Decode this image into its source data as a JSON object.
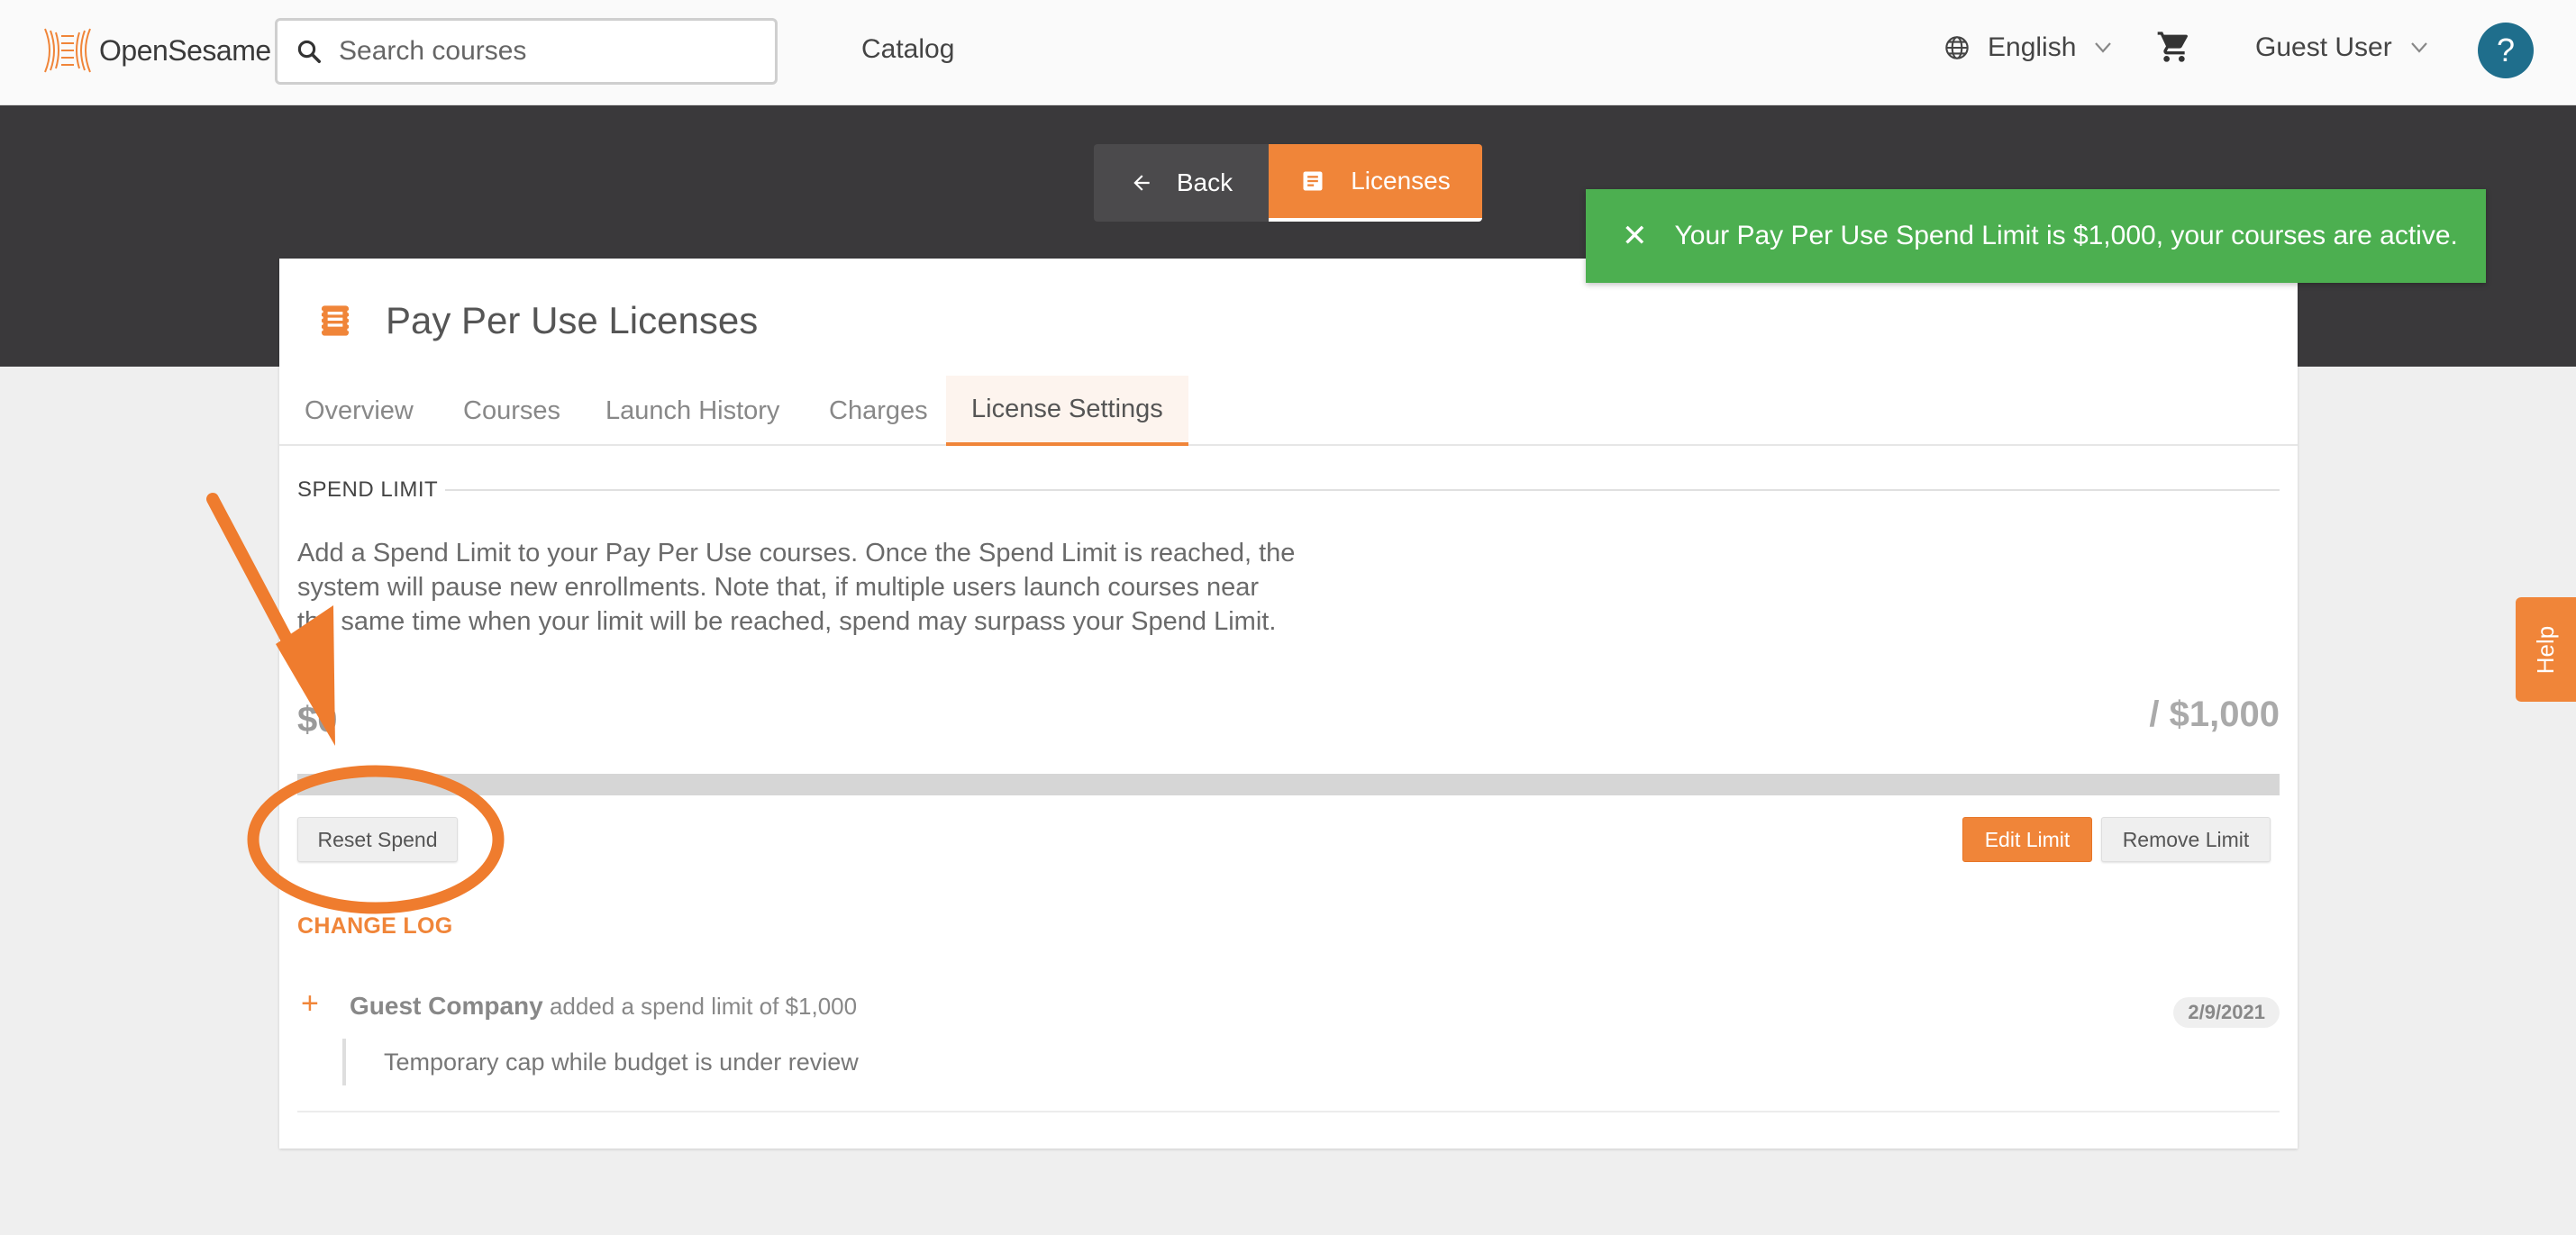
{
  "header": {
    "logo": {
      "text_a": "Open",
      "text_b": "Sesame"
    },
    "search": {
      "placeholder": "Search courses",
      "value": ""
    },
    "nav_catalog": "Catalog",
    "language": "English",
    "user": "Guest User",
    "help_glyph": "?"
  },
  "toolbar": {
    "back_label": "Back",
    "licenses_label": "Licenses"
  },
  "toast": {
    "message": "Your Pay Per Use Spend Limit is $1,000, your courses are active.",
    "close_glyph": "✕",
    "color": "#4caf50"
  },
  "card": {
    "title": "Pay Per Use Licenses",
    "tabs": [
      {
        "label": "Overview",
        "active": false
      },
      {
        "label": "Courses",
        "active": false
      },
      {
        "label": "Launch History",
        "active": false
      },
      {
        "label": "Charges",
        "active": false
      },
      {
        "label": "License Settings",
        "active": true
      }
    ]
  },
  "spend_limit": {
    "heading": "SPEND LIMIT",
    "description": "Add a Spend Limit to your Pay Per Use courses. Once the Spend Limit is reached, the system will pause new enrollments. Note that, if multiple users launch courses near the same time when your limit will be reached, spend may surpass your Spend Limit.",
    "spent": "$0",
    "limit": "/ $1,000",
    "progress_fraction": 0,
    "reset_label": "Reset Spend",
    "edit_label": "Edit Limit",
    "remove_label": "Remove Limit"
  },
  "change_log": {
    "heading": "CHANGE LOG",
    "entries": [
      {
        "actor": "Guest Company",
        "action": "added a spend limit of $1,000",
        "date": "2/9/2021",
        "note": "Temporary cap while budget is under review"
      }
    ]
  },
  "side_help": "Help",
  "colors": {
    "accent": "#f08539",
    "dark_band": "#3a393b",
    "help_blue": "#1f6e8c",
    "success": "#4caf50"
  }
}
